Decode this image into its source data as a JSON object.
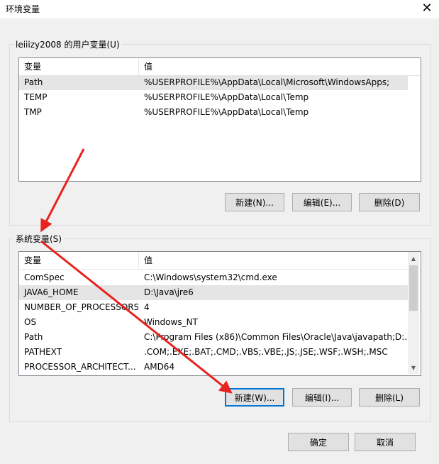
{
  "window": {
    "title": "环境变量",
    "close_glyph": "✕"
  },
  "user_vars": {
    "group_label": "leiiizy2008 的用户变量(U)",
    "columns": [
      "变量",
      "值"
    ],
    "rows": [
      {
        "name": "Path",
        "value": "%USERPROFILE%\\AppData\\Local\\Microsoft\\WindowsApps;"
      },
      {
        "name": "TEMP",
        "value": "%USERPROFILE%\\AppData\\Local\\Temp"
      },
      {
        "name": "TMP",
        "value": "%USERPROFILE%\\AppData\\Local\\Temp"
      }
    ],
    "buttons": {
      "new": "新建(N)...",
      "edit": "编辑(E)...",
      "delete": "删除(D)"
    }
  },
  "system_vars": {
    "group_label": "系统变量(S)",
    "columns": [
      "变量",
      "值"
    ],
    "rows": [
      {
        "name": "ComSpec",
        "value": "C:\\Windows\\system32\\cmd.exe"
      },
      {
        "name": "JAVA6_HOME",
        "value": "D:\\Java\\jre6"
      },
      {
        "name": "NUMBER_OF_PROCESSORS",
        "value": "4"
      },
      {
        "name": "OS",
        "value": "Windows_NT"
      },
      {
        "name": "Path",
        "value": "C:\\Program Files (x86)\\Common Files\\Oracle\\Java\\javapath;D:..."
      },
      {
        "name": "PATHEXT",
        "value": ".COM;.EXE;.BAT;.CMD;.VBS;.VBE;.JS;.JSE;.WSF;.WSH;.MSC"
      },
      {
        "name": "PROCESSOR_ARCHITECT...",
        "value": "AMD64"
      }
    ],
    "buttons": {
      "new": "新建(W)...",
      "edit": "编辑(I)...",
      "delete": "删除(L)"
    }
  },
  "footer": {
    "ok": "确定",
    "cancel": "取消"
  },
  "annotation_color": "#e8231f"
}
